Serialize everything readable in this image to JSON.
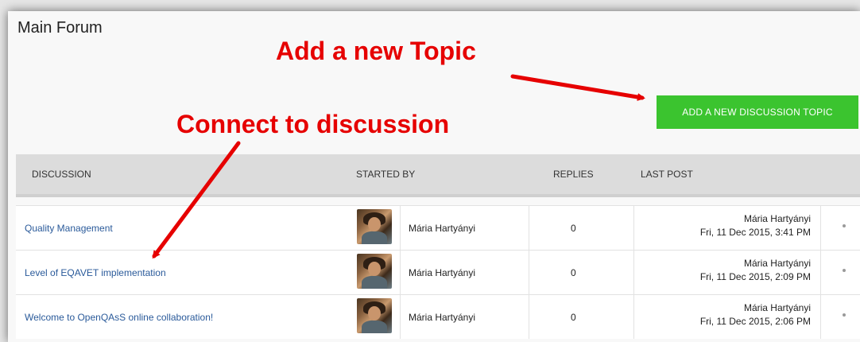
{
  "page_title": "Main Forum",
  "annotations": {
    "add_topic": "Add a new Topic",
    "connect": "Connect to discussion"
  },
  "add_button_label": "ADD A NEW DISCUSSION TOPIC",
  "table": {
    "headers": {
      "discussion": "DISCUSSION",
      "started_by": "STARTED BY",
      "replies": "REPLIES",
      "last_post": "LAST POST"
    },
    "rows": [
      {
        "title": "Quality Management",
        "author": "Mária Hartyányi",
        "replies": "0",
        "last_author": "Mária Hartyányi",
        "last_date": "Fri, 11 Dec 2015, 3:41 PM"
      },
      {
        "title": "Level of EQAVET implementation",
        "author": "Mária Hartyányi",
        "replies": "0",
        "last_author": "Mária Hartyányi",
        "last_date": "Fri, 11 Dec 2015, 2:09 PM"
      },
      {
        "title": "Welcome to OpenQAsS online collaboration!",
        "author": "Mária Hartyányi",
        "replies": "0",
        "last_author": "Mária Hartyányi",
        "last_date": "Fri, 11 Dec 2015, 2:06 PM"
      }
    ]
  },
  "colors": {
    "annotation_red": "#e60000",
    "button_green": "#3bc42f",
    "link_blue": "#2a5a9a"
  },
  "icons": [
    "avatar-photo",
    "row-menu-dot",
    "annotation-arrow"
  ]
}
